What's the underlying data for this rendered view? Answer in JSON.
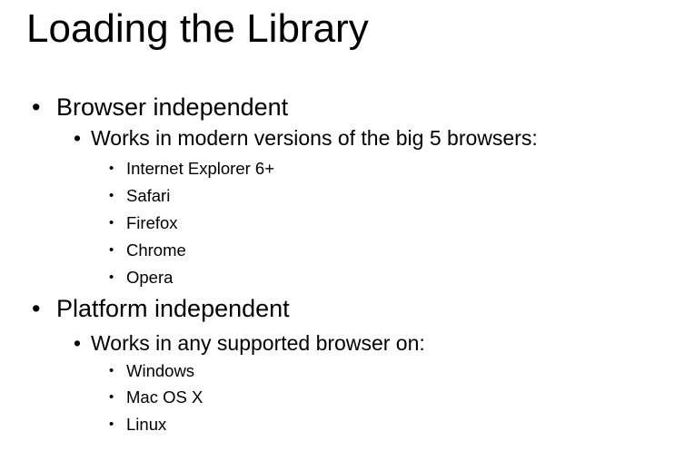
{
  "slide": {
    "title": "Loading the Library",
    "bullet_glyph": "•",
    "sections": [
      {
        "label": "Browser independent",
        "sub": {
          "label": "Works in modern versions of the big 5 browsers:",
          "items": [
            "Internet Explorer 6+",
            "Safari",
            "Firefox",
            "Chrome",
            "Opera"
          ]
        }
      },
      {
        "label": "Platform independent",
        "sub": {
          "label": "Works in any supported browser on:",
          "items": [
            "Windows",
            "Mac OS X",
            "Linux"
          ]
        }
      }
    ]
  }
}
